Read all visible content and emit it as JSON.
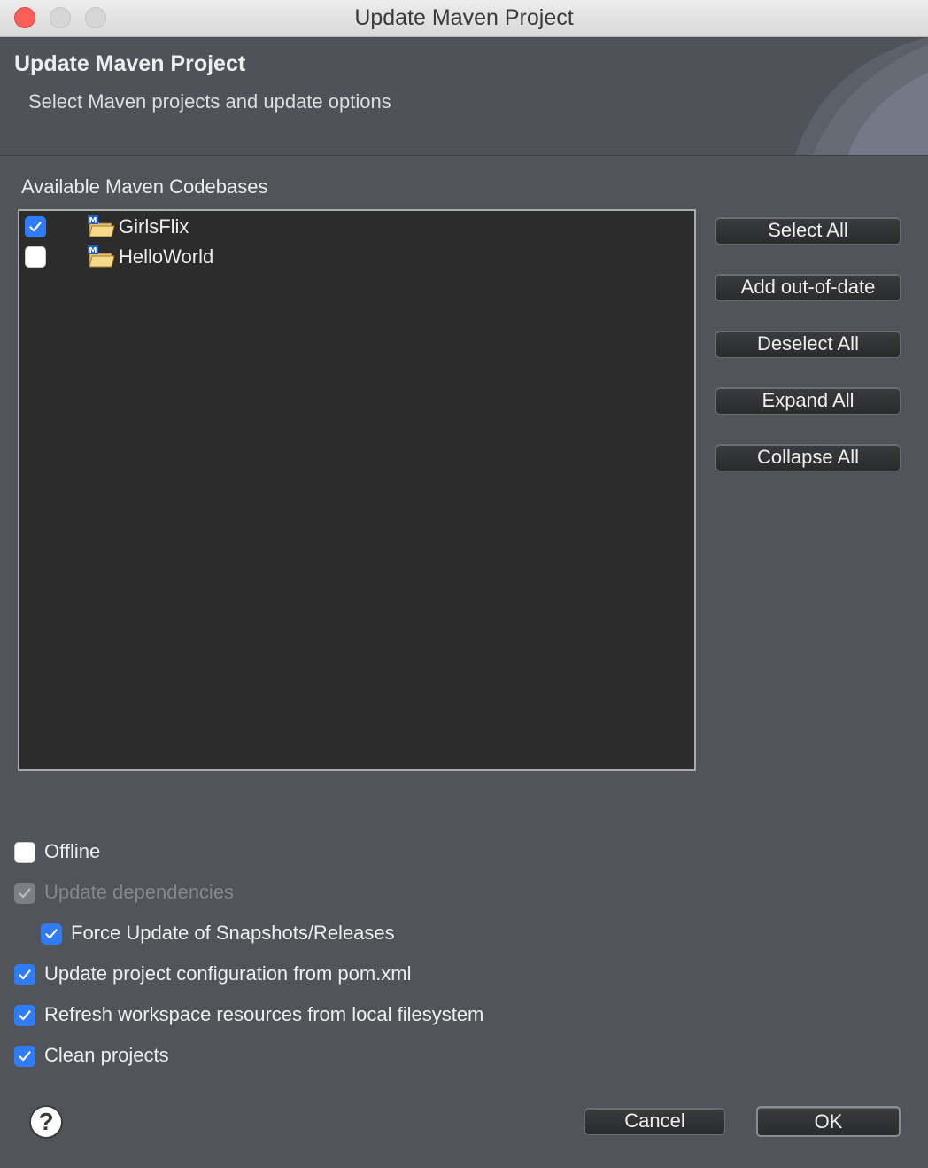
{
  "window": {
    "title": "Update Maven Project"
  },
  "header": {
    "title": "Update Maven Project",
    "description": "Select Maven projects and update options"
  },
  "codebases": {
    "label": "Available Maven Codebases",
    "items": [
      {
        "name": "GirlsFlix",
        "checked": true,
        "icon": "maven-project-folder-icon"
      },
      {
        "name": "HelloWorld",
        "checked": false,
        "icon": "maven-project-folder-icon"
      }
    ]
  },
  "side_buttons": {
    "select_all": "Select All",
    "add_out_of_date": "Add out-of-date",
    "deselect_all": "Deselect All",
    "expand_all": "Expand All",
    "collapse_all": "Collapse All"
  },
  "options": {
    "offline": {
      "label": "Offline",
      "checked": false
    },
    "update_dependencies": {
      "label": "Update dependencies",
      "checked": true,
      "disabled": true
    },
    "force_update": {
      "label": "Force Update of Snapshots/Releases",
      "checked": true
    },
    "update_config": {
      "label": "Update project configuration from pom.xml",
      "checked": true
    },
    "refresh_workspace": {
      "label": "Refresh workspace resources from local filesystem",
      "checked": true
    },
    "clean_projects": {
      "label": "Clean projects",
      "checked": true
    }
  },
  "footer": {
    "help_glyph": "?",
    "cancel": "Cancel",
    "ok": "OK"
  },
  "colors": {
    "accent": "#2f7cf6",
    "background": "#515459",
    "tree_background": "#2c2c2c"
  }
}
